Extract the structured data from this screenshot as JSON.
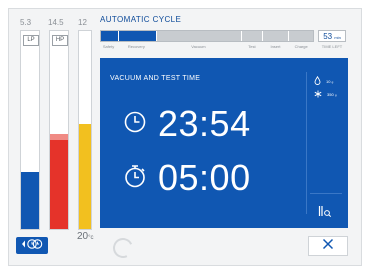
{
  "gauges": {
    "lp": {
      "label": "LP",
      "value": "5.3",
      "level": 0.29,
      "color": "#1057b2"
    },
    "hp": {
      "label": "HP",
      "value": "14.5",
      "level": 0.45,
      "color": "#e5332a"
    },
    "temp": {
      "value": "12",
      "level": 0.53,
      "color": "#f2c01f"
    },
    "scale_value": "20",
    "scale_unit": "°c"
  },
  "header": {
    "title": "AUTOMATIC CYCLE",
    "progress": 0.26,
    "phases": [
      "Safety",
      "Recovery",
      "Vacuum",
      "Test",
      "Insert",
      "Charge"
    ],
    "time_left_value": "53",
    "time_left_unit": "min",
    "time_left_label": "TIME LEFT"
  },
  "panel": {
    "title": "VACUUM AND TEST TIME",
    "time_elapsed": "23:54",
    "time_set": "05:00",
    "side": {
      "oil": {
        "value": "10",
        "unit": "g"
      },
      "refrigerant": {
        "value": "350",
        "unit": "g"
      }
    }
  },
  "icons": {
    "clock": "clock-icon",
    "stopwatch": "stopwatch-icon",
    "drop": "drop-icon",
    "snowflake": "snowflake-icon",
    "pause": "pause-zoom-icon",
    "nav": "back-options-icon",
    "close": "close-icon"
  },
  "colors": {
    "accent": "#1057b2",
    "background": "#f3f4f5",
    "text": "#0d4a99"
  }
}
